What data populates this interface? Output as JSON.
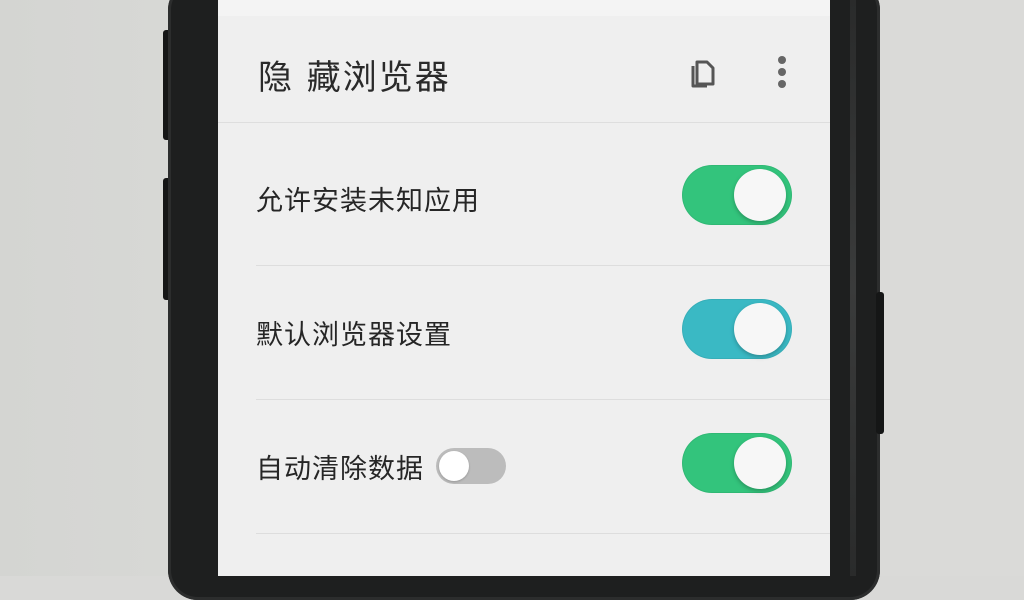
{
  "header": {
    "title": "隐 藏浏览器",
    "copy_icon": "copy-icon",
    "more_icon": "more-vertical-icon"
  },
  "settings": [
    {
      "label": "允许安装未知应用",
      "enabled": true,
      "color": "#33c47c"
    },
    {
      "label": "默认浏览器设置",
      "enabled": true,
      "color": "#3ab9c4"
    },
    {
      "label": "自动清除数据",
      "enabled": true,
      "color": "#33c47c",
      "inline_toggle_enabled": false
    }
  ],
  "colors": {
    "screen_bg": "#efefef",
    "text": "#262626",
    "inline_toggle_off": "#bcbcbc"
  }
}
